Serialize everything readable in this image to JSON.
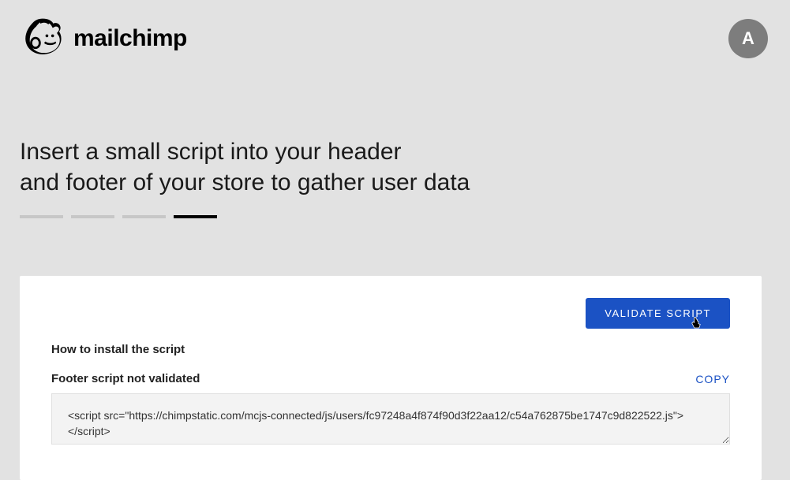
{
  "header": {
    "brand": "mailchimp",
    "avatar_initial": "A"
  },
  "page": {
    "title_line1": "Insert a small script into your header",
    "title_line2": "and footer of your store to gather user data"
  },
  "progress": {
    "total": 4,
    "active_index": 3
  },
  "card": {
    "validate_label": "VALIDATE SCRIPT",
    "install_heading": "How to install the script",
    "script_status_label": "Footer script not validated",
    "copy_label": "COPY",
    "script_value": "<script src=\"https://chimpstatic.com/mcjs-connected/js/users/fc97248a4f874f90d3f22aa12/c54a762875be1747c9d822522.js\"></script>"
  }
}
